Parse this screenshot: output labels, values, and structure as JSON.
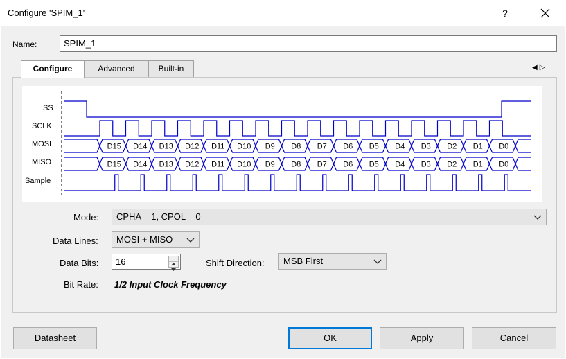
{
  "window": {
    "title": "Configure 'SPIM_1'",
    "help_label": "?"
  },
  "name_field": {
    "label": "Name:",
    "value": "SPIM_1"
  },
  "tabs": [
    {
      "label": "Configure",
      "active": true
    },
    {
      "label": "Advanced",
      "active": false
    },
    {
      "label": "Built-in",
      "active": false
    }
  ],
  "tab_nav": {
    "prev": "◀",
    "next": "▷"
  },
  "timing_diagram": {
    "signals": [
      "SS",
      "SCLK",
      "MOSI",
      "MISO",
      "Sample"
    ],
    "data_bits": [
      "D15",
      "D14",
      "D13",
      "D12",
      "D11",
      "D10",
      "D9",
      "D8",
      "D7",
      "D6",
      "D5",
      "D4",
      "D3",
      "D2",
      "D1",
      "D0"
    ],
    "color": "#0000cc"
  },
  "mode": {
    "label": "Mode:",
    "value": "CPHA = 1, CPOL = 0"
  },
  "data_lines": {
    "label": "Data Lines:",
    "value": "MOSI + MISO"
  },
  "data_bits": {
    "label": "Data Bits:",
    "value": "16"
  },
  "shift_direction": {
    "label": "Shift Direction:",
    "value": "MSB First"
  },
  "bit_rate": {
    "label": "Bit Rate:",
    "value": "1/2 Input Clock Frequency"
  },
  "buttons": {
    "datasheet": "Datasheet",
    "ok": "OK",
    "apply": "Apply",
    "cancel": "Cancel"
  }
}
